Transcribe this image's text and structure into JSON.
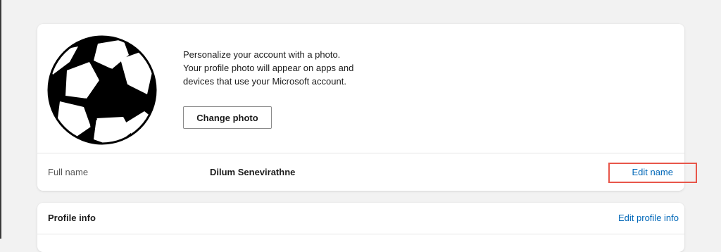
{
  "photo_section": {
    "avatar_icon": "soccer-ball-icon",
    "description": "Personalize your account with a photo. Your profile photo will appear on apps and devices that use your Microsoft account.",
    "change_photo_label": "Change photo"
  },
  "name_section": {
    "label": "Full name",
    "value": "Dilum Senevirathne",
    "edit_label": "Edit name"
  },
  "profile_info": {
    "title": "Profile info",
    "edit_label": "Edit profile info"
  },
  "colors": {
    "link": "#0067b8",
    "highlight": "#e8564a",
    "background": "#f2f2f2"
  }
}
